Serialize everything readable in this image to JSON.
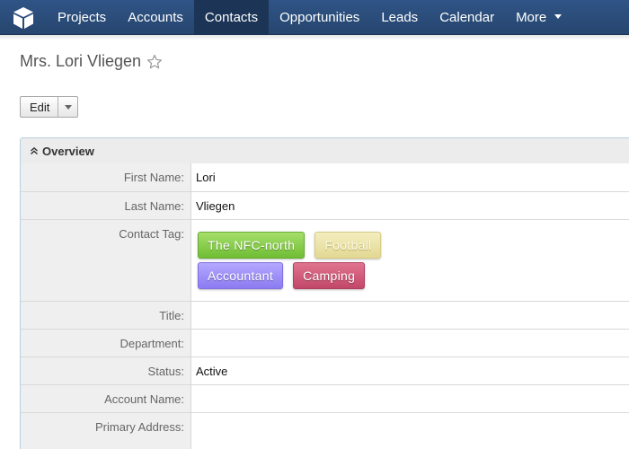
{
  "nav": {
    "logo_icon": "cube-icon",
    "items": [
      {
        "label": "Projects"
      },
      {
        "label": "Accounts"
      },
      {
        "label": "Contacts",
        "active": true
      },
      {
        "label": "Opportunities"
      },
      {
        "label": "Leads"
      },
      {
        "label": "Calendar"
      },
      {
        "label": "More"
      }
    ]
  },
  "record": {
    "title": "Mrs. Lori Vliegen",
    "favorite_icon": "star-icon"
  },
  "actions": {
    "edit_label": "Edit",
    "dropdown_icon": "caret-down-icon"
  },
  "panel": {
    "title": "Overview",
    "fields": {
      "first_name": {
        "label": "First Name:",
        "value": "Lori"
      },
      "last_name": {
        "label": "Last Name:",
        "value": "Vliegen"
      },
      "contact_tag": {
        "label": "Contact Tag:"
      },
      "title": {
        "label": "Title:",
        "value": ""
      },
      "department": {
        "label": "Department:",
        "value": ""
      },
      "status": {
        "label": "Status:",
        "value": "Active"
      },
      "account_name": {
        "label": "Account Name:",
        "value": ""
      },
      "primary_address": {
        "label": "Primary Address:",
        "value": ""
      }
    },
    "tags": [
      {
        "label": "The NFC-north",
        "color": "#8ccf4e"
      },
      {
        "label": "Football",
        "color": "#ebe3a8"
      },
      {
        "label": "Accountant",
        "color": "#9d8ff8"
      },
      {
        "label": "Camping",
        "color": "#d05c7c"
      }
    ]
  },
  "colors": {
    "nav_bg": "#2b4e7d",
    "nav_active": "#1c3556",
    "panel_border": "#b8cfe0"
  }
}
